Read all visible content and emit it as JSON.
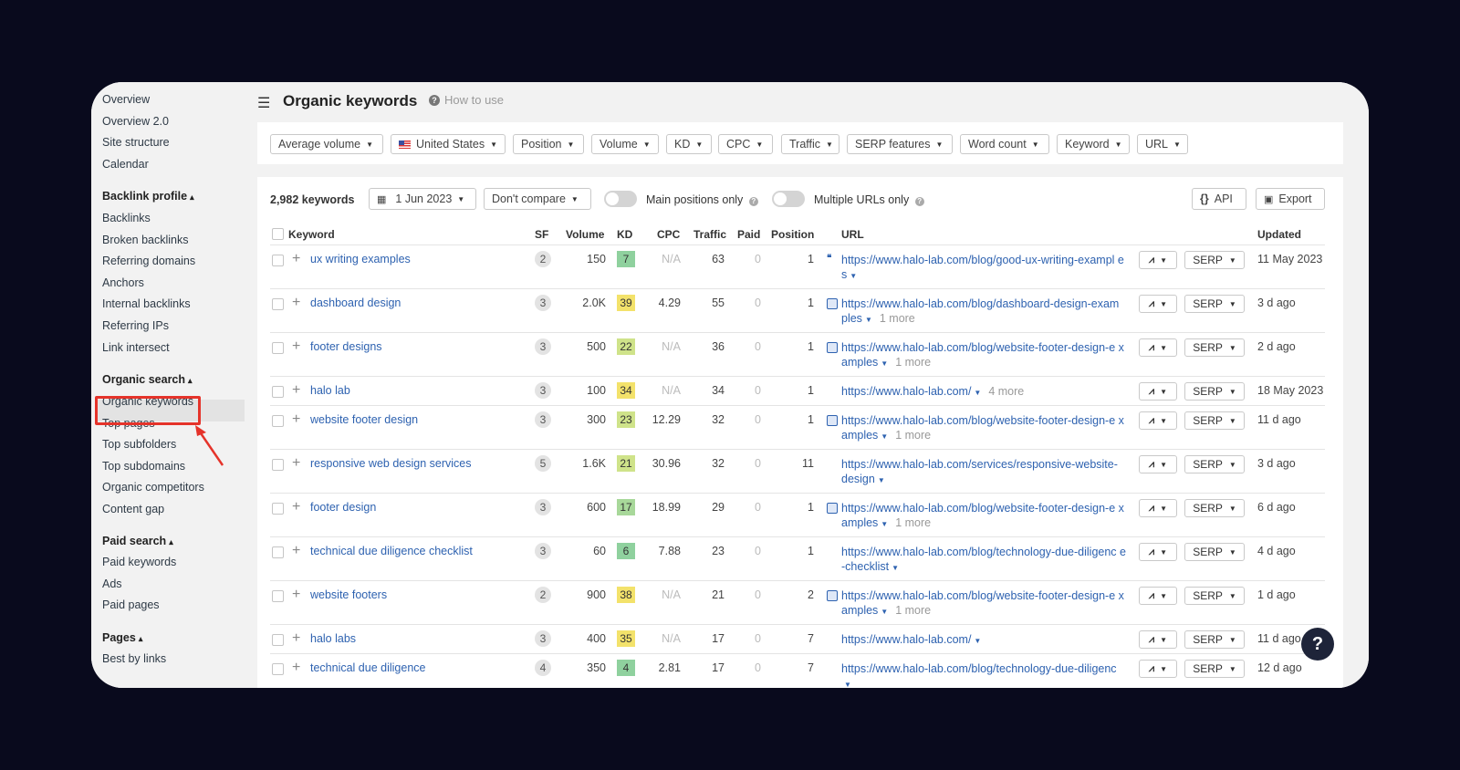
{
  "sidebar": {
    "links_top": [
      "Overview",
      "Overview 2.0",
      "Site structure",
      "Calendar"
    ],
    "backlink_profile": {
      "title": "Backlink profile",
      "items": [
        "Backlinks",
        "Broken backlinks",
        "Referring domains",
        "Anchors",
        "Internal backlinks",
        "Referring IPs",
        "Link intersect"
      ]
    },
    "organic_search": {
      "title": "Organic search",
      "items": [
        "Organic keywords",
        "Top pages",
        "Top subfolders",
        "Top subdomains",
        "Organic competitors",
        "Content gap"
      ]
    },
    "paid_search": {
      "title": "Paid search",
      "items": [
        "Paid keywords",
        "Ads",
        "Paid pages"
      ]
    },
    "pages": {
      "title": "Pages",
      "items": [
        "Best by links"
      ]
    },
    "caret": "▴"
  },
  "header": {
    "title": "Organic keywords",
    "how_to_use": "How to use"
  },
  "filters": [
    "Average volume",
    "United States",
    "Position",
    "Volume",
    "KD",
    "CPC",
    "Traffic",
    "SERP features",
    "Word count",
    "Keyword",
    "URL"
  ],
  "toolbar": {
    "count": "2,982 keywords",
    "date": "1 Jun 2023",
    "compare": "Don't compare",
    "main_positions": "Main positions only",
    "multiple_urls": "Multiple URLs only",
    "api": "API",
    "export": "Export"
  },
  "columns": [
    "Keyword",
    "SF",
    "Volume",
    "KD",
    "CPC",
    "Traffic",
    "Paid",
    "Position",
    "URL",
    "Updated"
  ],
  "rows": [
    {
      "keyword": "ux writing examples",
      "sf": "2",
      "volume": "150",
      "kd": "7",
      "kd_color": "#8fd19e",
      "cpc": "N/A",
      "traffic": "63",
      "paid": "0",
      "position": "1",
      "url": "https://www.halo-lab.com/blog/good-ux-writing-exampl es",
      "more": "",
      "icon": "quote",
      "updated": "11 May 2023"
    },
    {
      "keyword": "dashboard design",
      "sf": "3",
      "volume": "2.0K",
      "kd": "39",
      "kd_color": "#f3e26b",
      "cpc": "4.29",
      "traffic": "55",
      "paid": "0",
      "position": "1",
      "url": "https://www.halo-lab.com/blog/dashboard-design-exam ples",
      "more": "1 more",
      "icon": "image",
      "updated": "3 d ago"
    },
    {
      "keyword": "footer designs",
      "sf": "3",
      "volume": "500",
      "kd": "22",
      "kd_color": "#cfe38a",
      "cpc": "N/A",
      "traffic": "36",
      "paid": "0",
      "position": "1",
      "url": "https://www.halo-lab.com/blog/website-footer-design-e xamples",
      "more": "1 more",
      "icon": "image",
      "updated": "2 d ago"
    },
    {
      "keyword": "halo lab",
      "sf": "3",
      "volume": "100",
      "kd": "34",
      "kd_color": "#f3e26b",
      "cpc": "N/A",
      "traffic": "34",
      "paid": "0",
      "position": "1",
      "url": "https://www.halo-lab.com/",
      "more": "4 more",
      "icon": "",
      "updated": "18 May 2023"
    },
    {
      "keyword": "website footer design",
      "sf": "3",
      "volume": "300",
      "kd": "23",
      "kd_color": "#cfe38a",
      "cpc": "12.29",
      "traffic": "32",
      "paid": "0",
      "position": "1",
      "url": "https://www.halo-lab.com/blog/website-footer-design-e xamples",
      "more": "1 more",
      "icon": "image",
      "updated": "11 d ago"
    },
    {
      "keyword": "responsive web design services",
      "sf": "5",
      "volume": "1.6K",
      "kd": "21",
      "kd_color": "#cfe38a",
      "cpc": "30.96",
      "traffic": "32",
      "paid": "0",
      "position": "11",
      "url": "https://www.halo-lab.com/services/responsive-website- design",
      "more": "",
      "icon": "",
      "updated": "3 d ago"
    },
    {
      "keyword": "footer design",
      "sf": "3",
      "volume": "600",
      "kd": "17",
      "kd_color": "#a8d89a",
      "cpc": "18.99",
      "traffic": "29",
      "paid": "0",
      "position": "1",
      "url": "https://www.halo-lab.com/blog/website-footer-design-e xamples",
      "more": "1 more",
      "icon": "image",
      "updated": "6 d ago"
    },
    {
      "keyword": "technical due diligence checklist",
      "sf": "3",
      "volume": "60",
      "kd": "6",
      "kd_color": "#8fd19e",
      "cpc": "7.88",
      "traffic": "23",
      "paid": "0",
      "position": "1",
      "url": "https://www.halo-lab.com/blog/technology-due-diligenc e-checklist",
      "more": "",
      "icon": "",
      "updated": "4 d ago"
    },
    {
      "keyword": "website footers",
      "sf": "2",
      "volume": "900",
      "kd": "38",
      "kd_color": "#f3e26b",
      "cpc": "N/A",
      "traffic": "21",
      "paid": "0",
      "position": "2",
      "url": "https://www.halo-lab.com/blog/website-footer-design-e xamples",
      "more": "1 more",
      "icon": "image",
      "updated": "1 d ago"
    },
    {
      "keyword": "halo labs",
      "sf": "3",
      "volume": "400",
      "kd": "35",
      "kd_color": "#f3e26b",
      "cpc": "N/A",
      "traffic": "17",
      "paid": "0",
      "position": "7",
      "url": "https://www.halo-lab.com/",
      "more": "",
      "icon": "",
      "updated": "11 d ago"
    },
    {
      "keyword": "technical due diligence",
      "sf": "4",
      "volume": "350",
      "kd": "4",
      "kd_color": "#8fd19e",
      "cpc": "2.81",
      "traffic": "17",
      "paid": "0",
      "position": "7",
      "url": "https://www.halo-lab.com/blog/technology-due-diligenc",
      "more": "",
      "icon": "",
      "updated": "12 d ago"
    }
  ],
  "serp_label": "SERP",
  "help_label": "?"
}
